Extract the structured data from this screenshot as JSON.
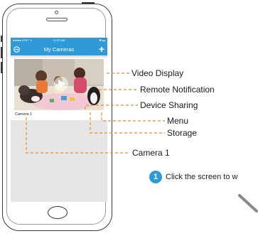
{
  "status_bar": {
    "carrier": "●●●●● AT&T ᯤ",
    "time": "11:57 AM",
    "battery": "✱ ▬"
  },
  "nav": {
    "title": "My Cameras",
    "left_icon": "settings-circle-icon",
    "add_label": "+"
  },
  "camera_card": {
    "name": "Camera 1",
    "play_icon": "play-icon",
    "menu_icon": "menu-dots-icon"
  },
  "callouts": {
    "video_display": "Video Display",
    "remote_notification": "Remote Notification",
    "device_sharing": "Device Sharing",
    "menu": "Menu",
    "storage": "Storage",
    "camera_1": "Camera 1"
  },
  "step": {
    "number": "1",
    "text": "Click the screen to w"
  },
  "colors": {
    "accent": "#2f9ad8",
    "leader": "#f08a24",
    "screen_bg": "#e6e6e6"
  }
}
